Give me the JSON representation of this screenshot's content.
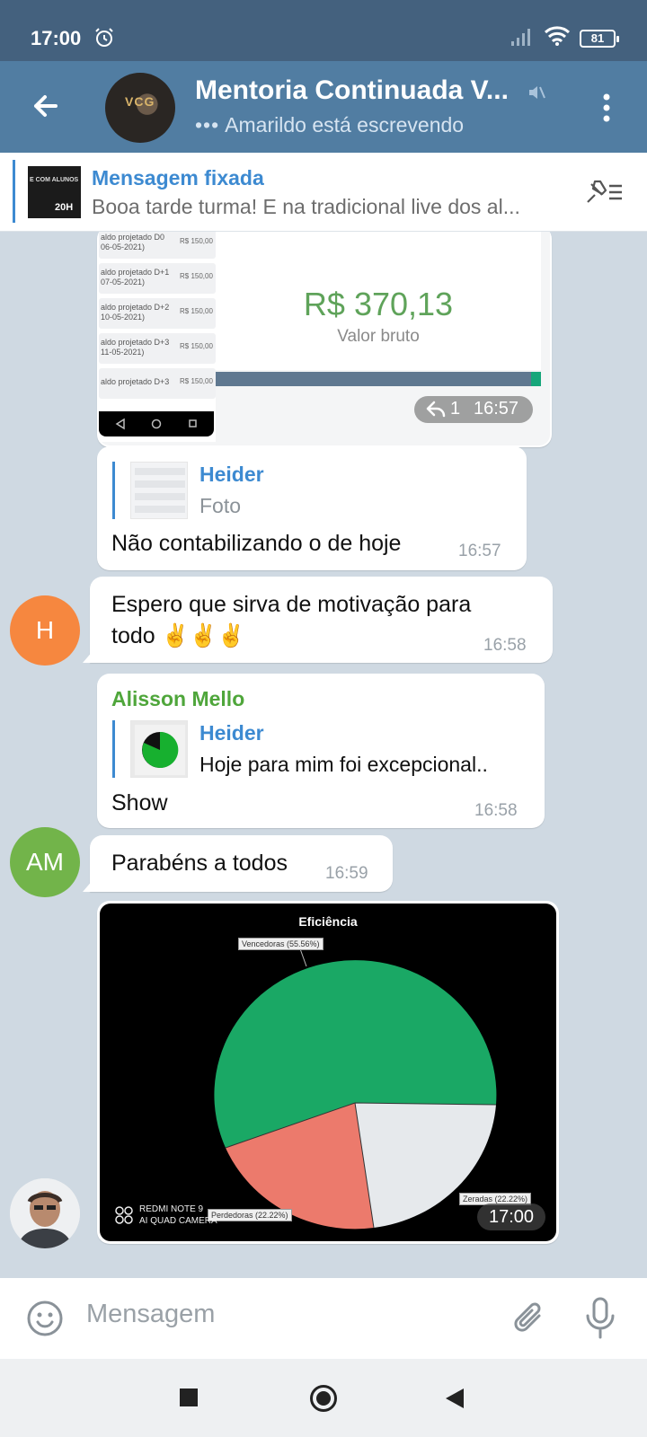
{
  "status_bar": {
    "time": "17:00",
    "battery": "81"
  },
  "header": {
    "title": "Mentoria Continuada V...",
    "typing_status": "Amarildo está escrevendo",
    "avatar_text": "VCG"
  },
  "pinned": {
    "title": "Mensagem fixada",
    "text": "Booa tarde turma!  E na tradicional live dos al...",
    "thumb_line1": "E COM ALUNOS",
    "thumb_line2": "20H"
  },
  "messages": {
    "image1": {
      "rows": [
        {
          "label": "aldo projetado D0\n06-05-2021)",
          "value": "R$ 150,00"
        },
        {
          "label": "aldo projetado D+1\n07-05-2021)",
          "value": "R$ 150,00"
        },
        {
          "label": "aldo projetado D+2\n10-05-2021)",
          "value": "R$ 150,00"
        },
        {
          "label": "aldo projetado D+3\n11-05-2021)",
          "value": "R$ 150,00"
        },
        {
          "label": "aldo projetado D+3",
          "value": "R$ 150,00"
        }
      ],
      "amount": "R$ 370,13",
      "amount_label": "Valor bruto",
      "progress_fraction": 0.03,
      "replies_count": "1",
      "time": "16:57"
    },
    "reply1": {
      "quoted_name": "Heider",
      "quoted_text": "Foto",
      "text": "Não contabilizando o de hoje",
      "time": "16:57"
    },
    "msg_h": {
      "avatar_initial": "H",
      "avatar_color": "#f6873f",
      "line1": "Espero que sirva de motivação para",
      "line2": "todo ✌️✌️✌️",
      "time": "16:58"
    },
    "reply2": {
      "sender": "Alisson Mello",
      "quoted_name": "Heider",
      "quoted_text": "Hoje para mim foi excepcional..",
      "text": "Show",
      "time": "16:58"
    },
    "msg_am": {
      "avatar_initial": "AM",
      "avatar_color": "#72b44a",
      "text": "Parabéns a todos",
      "time": "16:59"
    },
    "image2": {
      "title": "Eficiência",
      "label_winners": "Vencedoras (55.56%)",
      "label_losers": "Perdedoras (22.22%)",
      "label_zeroed": "Zeradas (22.22%)",
      "camera_line1": "REDMI NOTE 9",
      "camera_line2": "AI QUAD CAMERA",
      "time": "17:00"
    }
  },
  "input": {
    "placeholder": "Mensagem"
  },
  "colors": {
    "header": "#517da2",
    "status_bar": "#44617e",
    "accent": "#3d8ad1",
    "sender_green": "#4fa63b"
  }
}
